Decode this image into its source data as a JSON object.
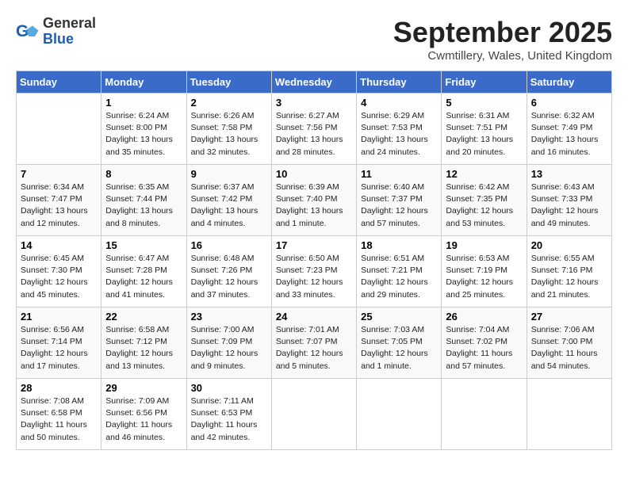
{
  "header": {
    "logo_line1": "General",
    "logo_line2": "Blue",
    "month_title": "September 2025",
    "location": "Cwmtillery, Wales, United Kingdom"
  },
  "weekdays": [
    "Sunday",
    "Monday",
    "Tuesday",
    "Wednesday",
    "Thursday",
    "Friday",
    "Saturday"
  ],
  "weeks": [
    [
      {
        "num": "",
        "info": ""
      },
      {
        "num": "1",
        "info": "Sunrise: 6:24 AM\nSunset: 8:00 PM\nDaylight: 13 hours\nand 35 minutes."
      },
      {
        "num": "2",
        "info": "Sunrise: 6:26 AM\nSunset: 7:58 PM\nDaylight: 13 hours\nand 32 minutes."
      },
      {
        "num": "3",
        "info": "Sunrise: 6:27 AM\nSunset: 7:56 PM\nDaylight: 13 hours\nand 28 minutes."
      },
      {
        "num": "4",
        "info": "Sunrise: 6:29 AM\nSunset: 7:53 PM\nDaylight: 13 hours\nand 24 minutes."
      },
      {
        "num": "5",
        "info": "Sunrise: 6:31 AM\nSunset: 7:51 PM\nDaylight: 13 hours\nand 20 minutes."
      },
      {
        "num": "6",
        "info": "Sunrise: 6:32 AM\nSunset: 7:49 PM\nDaylight: 13 hours\nand 16 minutes."
      }
    ],
    [
      {
        "num": "7",
        "info": "Sunrise: 6:34 AM\nSunset: 7:47 PM\nDaylight: 13 hours\nand 12 minutes."
      },
      {
        "num": "8",
        "info": "Sunrise: 6:35 AM\nSunset: 7:44 PM\nDaylight: 13 hours\nand 8 minutes."
      },
      {
        "num": "9",
        "info": "Sunrise: 6:37 AM\nSunset: 7:42 PM\nDaylight: 13 hours\nand 4 minutes."
      },
      {
        "num": "10",
        "info": "Sunrise: 6:39 AM\nSunset: 7:40 PM\nDaylight: 13 hours\nand 1 minute."
      },
      {
        "num": "11",
        "info": "Sunrise: 6:40 AM\nSunset: 7:37 PM\nDaylight: 12 hours\nand 57 minutes."
      },
      {
        "num": "12",
        "info": "Sunrise: 6:42 AM\nSunset: 7:35 PM\nDaylight: 12 hours\nand 53 minutes."
      },
      {
        "num": "13",
        "info": "Sunrise: 6:43 AM\nSunset: 7:33 PM\nDaylight: 12 hours\nand 49 minutes."
      }
    ],
    [
      {
        "num": "14",
        "info": "Sunrise: 6:45 AM\nSunset: 7:30 PM\nDaylight: 12 hours\nand 45 minutes."
      },
      {
        "num": "15",
        "info": "Sunrise: 6:47 AM\nSunset: 7:28 PM\nDaylight: 12 hours\nand 41 minutes."
      },
      {
        "num": "16",
        "info": "Sunrise: 6:48 AM\nSunset: 7:26 PM\nDaylight: 12 hours\nand 37 minutes."
      },
      {
        "num": "17",
        "info": "Sunrise: 6:50 AM\nSunset: 7:23 PM\nDaylight: 12 hours\nand 33 minutes."
      },
      {
        "num": "18",
        "info": "Sunrise: 6:51 AM\nSunset: 7:21 PM\nDaylight: 12 hours\nand 29 minutes."
      },
      {
        "num": "19",
        "info": "Sunrise: 6:53 AM\nSunset: 7:19 PM\nDaylight: 12 hours\nand 25 minutes."
      },
      {
        "num": "20",
        "info": "Sunrise: 6:55 AM\nSunset: 7:16 PM\nDaylight: 12 hours\nand 21 minutes."
      }
    ],
    [
      {
        "num": "21",
        "info": "Sunrise: 6:56 AM\nSunset: 7:14 PM\nDaylight: 12 hours\nand 17 minutes."
      },
      {
        "num": "22",
        "info": "Sunrise: 6:58 AM\nSunset: 7:12 PM\nDaylight: 12 hours\nand 13 minutes."
      },
      {
        "num": "23",
        "info": "Sunrise: 7:00 AM\nSunset: 7:09 PM\nDaylight: 12 hours\nand 9 minutes."
      },
      {
        "num": "24",
        "info": "Sunrise: 7:01 AM\nSunset: 7:07 PM\nDaylight: 12 hours\nand 5 minutes."
      },
      {
        "num": "25",
        "info": "Sunrise: 7:03 AM\nSunset: 7:05 PM\nDaylight: 12 hours\nand 1 minute."
      },
      {
        "num": "26",
        "info": "Sunrise: 7:04 AM\nSunset: 7:02 PM\nDaylight: 11 hours\nand 57 minutes."
      },
      {
        "num": "27",
        "info": "Sunrise: 7:06 AM\nSunset: 7:00 PM\nDaylight: 11 hours\nand 54 minutes."
      }
    ],
    [
      {
        "num": "28",
        "info": "Sunrise: 7:08 AM\nSunset: 6:58 PM\nDaylight: 11 hours\nand 50 minutes."
      },
      {
        "num": "29",
        "info": "Sunrise: 7:09 AM\nSunset: 6:56 PM\nDaylight: 11 hours\nand 46 minutes."
      },
      {
        "num": "30",
        "info": "Sunrise: 7:11 AM\nSunset: 6:53 PM\nDaylight: 11 hours\nand 42 minutes."
      },
      {
        "num": "",
        "info": ""
      },
      {
        "num": "",
        "info": ""
      },
      {
        "num": "",
        "info": ""
      },
      {
        "num": "",
        "info": ""
      }
    ]
  ]
}
